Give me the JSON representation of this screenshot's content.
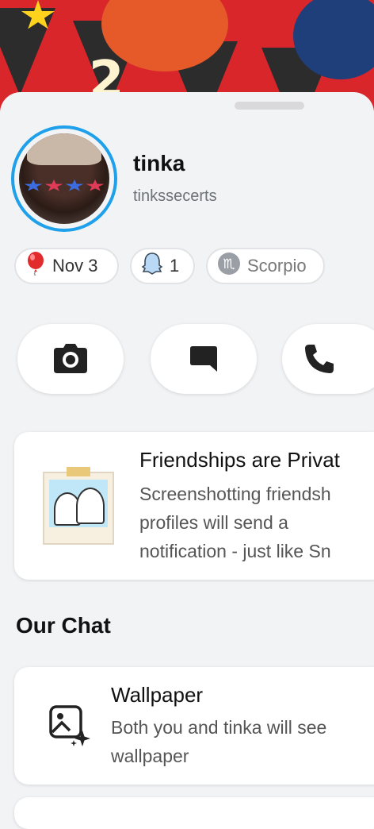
{
  "banner": {
    "year_digit": "2"
  },
  "profile": {
    "display_name": "tinka",
    "username": "tinkssecerts"
  },
  "badges": [
    {
      "icon": "balloon-icon",
      "label": "Nov 3"
    },
    {
      "icon": "ghost-icon",
      "label": "1"
    },
    {
      "icon": "scorpio-icon",
      "label": "Scorpio"
    }
  ],
  "actions": [
    "camera-icon",
    "chat-icon",
    "phone-icon"
  ],
  "privacy_card": {
    "title": "Friendships are Privat",
    "lines": [
      "Screenshotting friendsh",
      "profiles will send a",
      "notification - just like Sn"
    ]
  },
  "our_chat": {
    "heading": "Our Chat",
    "wallpaper": {
      "title": "Wallpaper",
      "lines": [
        "Both you and tinka will see",
        "wallpaper"
      ]
    }
  },
  "colors": {
    "ring": "#1ea0ea",
    "banner": "#d8262b"
  }
}
